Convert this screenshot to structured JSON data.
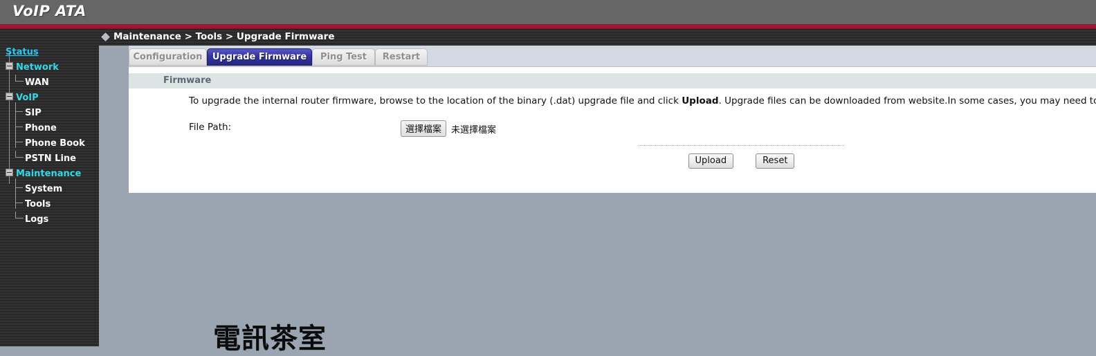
{
  "header": {
    "brand": "VoIP ATA"
  },
  "breadcrumb": {
    "text": "Maintenance > Tools > Upgrade Firmware"
  },
  "sidebar": {
    "items": [
      {
        "label": "Status",
        "level": "root"
      },
      {
        "label": "Network",
        "level": "group"
      },
      {
        "label": "WAN",
        "level": "child"
      },
      {
        "label": "VoIP",
        "level": "group"
      },
      {
        "label": "SIP",
        "level": "child"
      },
      {
        "label": "Phone",
        "level": "child"
      },
      {
        "label": "Phone Book",
        "level": "child"
      },
      {
        "label": "PSTN Line",
        "level": "child"
      },
      {
        "label": "Maintenance",
        "level": "group"
      },
      {
        "label": "System",
        "level": "child"
      },
      {
        "label": "Tools",
        "level": "child"
      },
      {
        "label": "Logs",
        "level": "child"
      }
    ]
  },
  "tabs": [
    {
      "label": "Configuration",
      "active": false
    },
    {
      "label": "Upgrade Firmware",
      "active": true
    },
    {
      "label": "Ping Test",
      "active": false
    },
    {
      "label": "Restart",
      "active": false
    }
  ],
  "section": {
    "title": "Firmware",
    "intro_part1": "To upgrade the internal router firmware, browse to the location of the binary (.dat) upgrade file and click ",
    "intro_bold": "Upload",
    "intro_part2": ". Upgrade files can be downloaded from website.In some cases, you may need to reconfigure"
  },
  "form": {
    "file_path_label": "File Path:",
    "choose_file_button": "選擇檔案",
    "no_file_text": "未選擇檔案",
    "upload_button": "Upload",
    "reset_button": "Reset"
  },
  "watermark": {
    "text": "電訊茶室"
  },
  "colors": {
    "brand_bar": "#666666",
    "red_rule": "#9b1733",
    "sidebar_link": "#2ad4f0",
    "active_tab": "#2f2f9c",
    "page_bg": "#9aa5b1"
  }
}
